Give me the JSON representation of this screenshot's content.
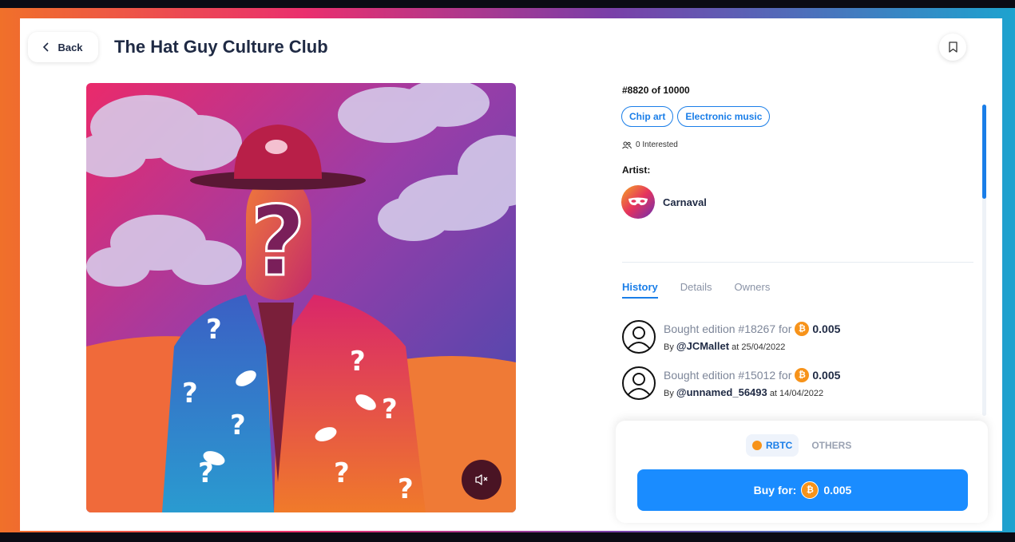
{
  "header": {
    "back_label": "Back",
    "title": "The Hat Guy Culture Club"
  },
  "nft": {
    "edition": "#8820 of 10000",
    "tags": [
      "Chip art",
      "Electronic music"
    ],
    "interested": "0 Interested",
    "artist_label": "Artist:",
    "artist_name": "Carnaval"
  },
  "tabs": [
    {
      "label": "History",
      "active": true
    },
    {
      "label": "Details",
      "active": false
    },
    {
      "label": "Owners",
      "active": false
    }
  ],
  "history": [
    {
      "action": "Bought edition #18267 for",
      "amount": "0.005",
      "by": "By",
      "user": "@JCMallet",
      "at": "at 25/04/2022"
    },
    {
      "action": "Bought edition #15012 for",
      "amount": "0.005",
      "by": "By",
      "user": "@unnamed_56493",
      "at": "at 14/04/2022"
    }
  ],
  "purchase": {
    "currencies": [
      "RBTC",
      "OTHERS"
    ],
    "selected_currency": "RBTC",
    "buy_label": "Buy for:",
    "price": "0.005"
  },
  "colors": {
    "accent": "#1a8cff",
    "bitcoin": "#f7931a",
    "title": "#1f2a44"
  },
  "icons": {
    "back": "chevron-left-icon",
    "bookmark": "bookmark-icon",
    "mute": "speaker-muted-icon",
    "users": "users-icon"
  }
}
